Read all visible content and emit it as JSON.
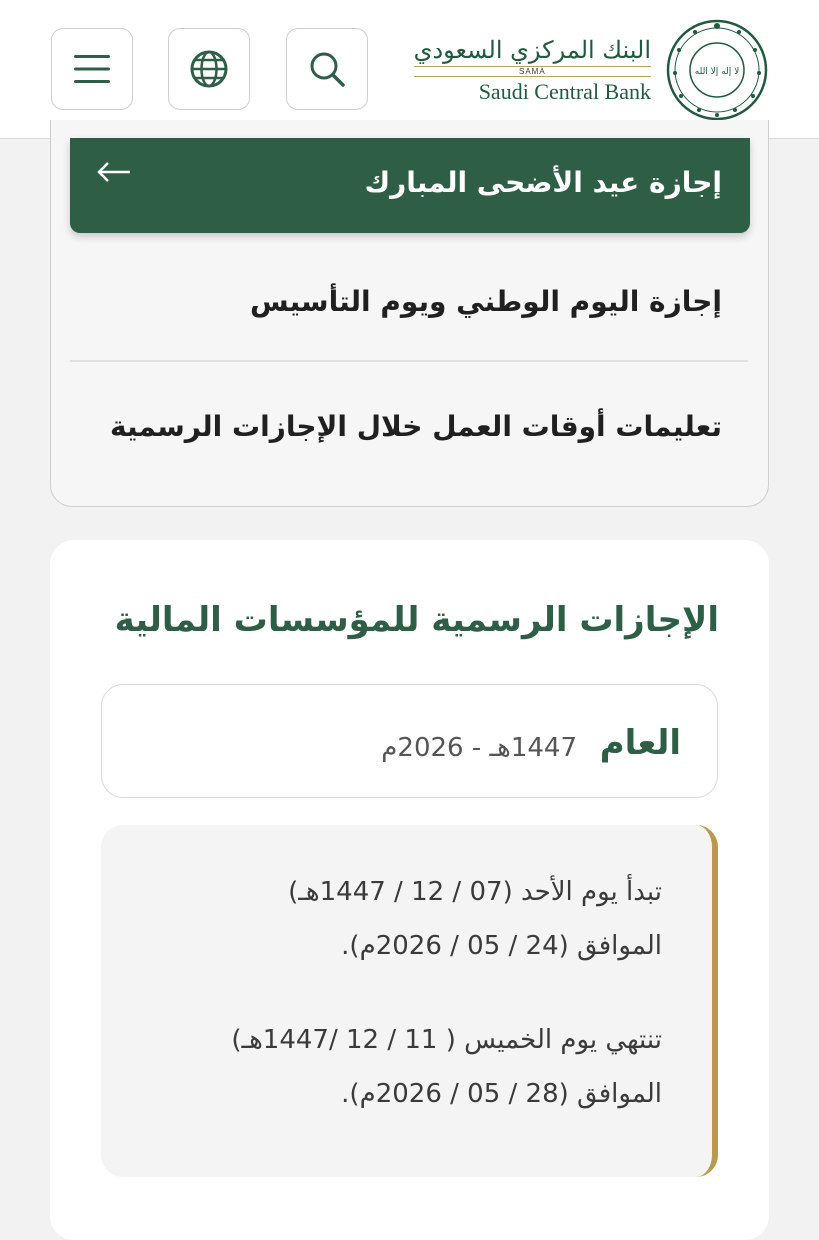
{
  "header": {
    "logo_ar": "البنك المركزي السعودي",
    "logo_sama": "SAMA",
    "logo_en": "Saudi Central Bank",
    "seal_text": "لا إله إلا الله",
    "buttons": [
      {
        "icon": "menu-icon"
      },
      {
        "icon": "globe-icon"
      },
      {
        "icon": "search-icon"
      }
    ]
  },
  "menu": {
    "active_item": "إجازة عيد الأضحى المبارك",
    "items": [
      "إجازة اليوم الوطني ويوم التأسيس",
      "تعليمات أوقات العمل خلال الإجازات الرسمية"
    ]
  },
  "holidays": {
    "title": "الإجازات الرسمية للمؤسسات المالية",
    "year_label": "العام",
    "year_value": "1447هـ - 2026م",
    "start_line1": "تبدأ يوم الأحد (07 / 12 / 1447هـ)",
    "start_line2": "الموافق (24 / 05 / 2026م).",
    "end_line1": "تنتهي يوم الخميس ( 11 / 12 /1447هـ)",
    "end_line2": "الموافق (28 / 05 / 2026م)."
  },
  "colors": {
    "brand_green": "#2f5e47",
    "gold_accent": "#b89a4f"
  }
}
